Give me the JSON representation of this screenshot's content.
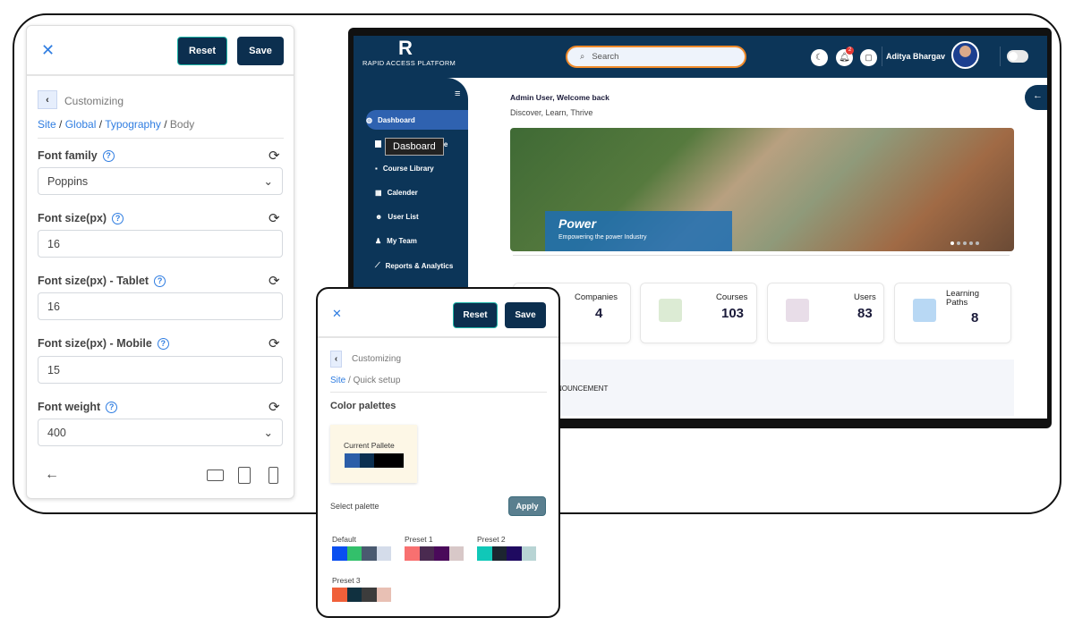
{
  "left_panel": {
    "close_icon": "close-icon",
    "reset": "Reset",
    "save": "Save",
    "customizing": "Customizing",
    "breadcrumb": [
      {
        "label": "Site",
        "link": true
      },
      {
        "label": "Global",
        "link": true
      },
      {
        "label": "Typography",
        "link": true
      },
      {
        "label": "Body",
        "link": false
      }
    ],
    "fields": [
      {
        "label": "Font family",
        "value": "Poppins",
        "type": "select"
      },
      {
        "label": "Font size(px)",
        "value": "16",
        "type": "input"
      },
      {
        "label": "Font size(px) - Tablet",
        "value": "16",
        "type": "input"
      },
      {
        "label": "Font size(px) - Mobile",
        "value": "15",
        "type": "input"
      },
      {
        "label": "Font weight",
        "value": "400",
        "type": "select"
      }
    ]
  },
  "app": {
    "logo_text": "RAPID ACCESS PLATFORM",
    "search_placeholder": "Search",
    "notification_count": "2",
    "user_name": "Aditya Bhargav",
    "sidebar": [
      {
        "label": "Dashboard",
        "active": true
      },
      {
        "label": "ue"
      },
      {
        "label": "Course Library"
      },
      {
        "label": "Calender"
      },
      {
        "label": "User List"
      },
      {
        "label": "My Team"
      },
      {
        "label": "Reports & Analytics"
      }
    ],
    "tooltip": "Dasboard",
    "welcome": "Admin User, Welcome back",
    "tagline": "Discover, Learn, Thrive",
    "banner": {
      "title": "Power",
      "subtitle": "Empowering the power Industry",
      "slides": 5,
      "active_slide": 1
    },
    "stats": [
      {
        "label": "Companies",
        "value": "4"
      },
      {
        "label": "Courses",
        "value": "103"
      },
      {
        "label": "Users",
        "value": "83"
      },
      {
        "label": "Learning Paths",
        "value": "8"
      }
    ],
    "announcement": "NOUNCEMENT"
  },
  "mobile_panel": {
    "reset": "Reset",
    "save": "Save",
    "customizing": "Customizing",
    "breadcrumb": [
      {
        "label": "Site",
        "link": true
      },
      {
        "label": "Quick setup",
        "link": false
      }
    ],
    "section": "Color palettes",
    "current_label": "Current Pallete",
    "current_colors": [
      "#2b5ea8",
      "#0b3050",
      "#000000",
      "#000000"
    ],
    "select_label": "Select palette",
    "apply": "Apply",
    "presets": [
      {
        "name": "Default",
        "colors": [
          "#0a4ff0",
          "#33c06b",
          "#4a5a70",
          "#d4dcea"
        ]
      },
      {
        "name": "Preset 1",
        "colors": [
          "#f87070",
          "#4a2a50",
          "#4a0a5a",
          "#d8c8c8"
        ]
      },
      {
        "name": "Preset 2",
        "colors": [
          "#10c8b8",
          "#1c2530",
          "#1f0a60",
          "#b8d4d4"
        ]
      },
      {
        "name": "Preset 3",
        "colors": [
          "#f0603a",
          "#10303f",
          "#3c3c3c",
          "#e8c0b4"
        ]
      }
    ]
  },
  "colors": {
    "navy": "#0c3558",
    "accent_blue": "#2f7de1",
    "button": "#0c2f4f"
  }
}
